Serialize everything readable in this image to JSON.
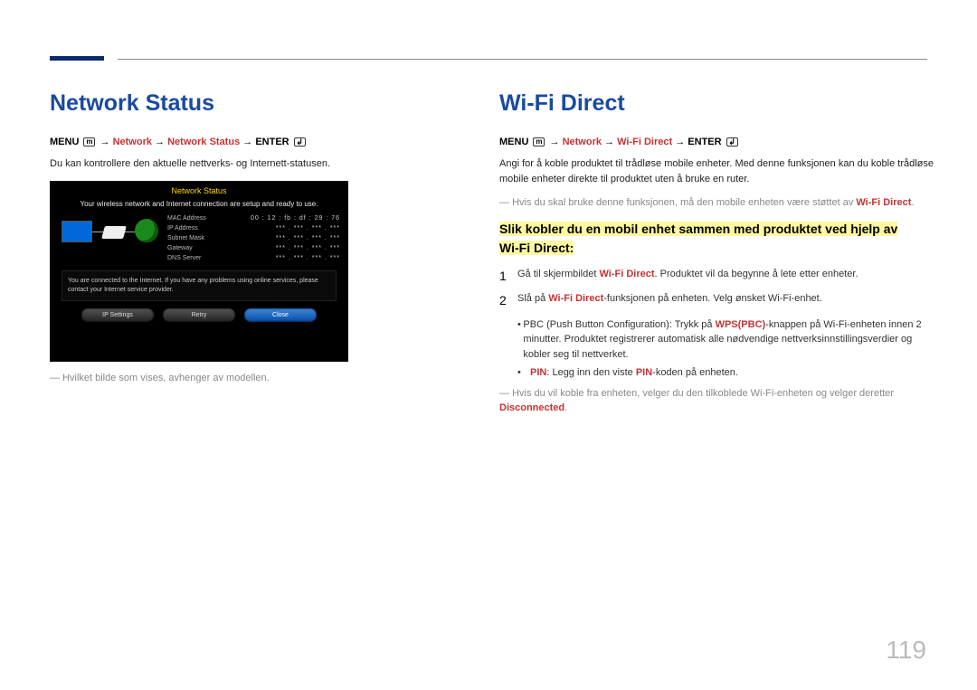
{
  "page_number": "119",
  "left": {
    "heading": "Network Status",
    "menu": {
      "prefix": "MENU",
      "item1": "Network",
      "item2": "Network Status",
      "suffix": "ENTER",
      "arrow": "→"
    },
    "intro": "Du kan kontrollere den aktuelle nettverks- og Internett-statusen.",
    "ss": {
      "title": "Network Status",
      "subtitle": "Your wireless network and Internet connection are setup and ready to use.",
      "rows": [
        {
          "label": "MAC Address",
          "value": "00 : 12 : fb : df : 29 : 76"
        },
        {
          "label": "IP Address",
          "value": "*** . *** . *** . ***"
        },
        {
          "label": "Subnet Mask",
          "value": "*** . *** . *** . ***"
        },
        {
          "label": "Gateway",
          "value": "*** . *** . *** . ***"
        },
        {
          "label": "DNS Server",
          "value": "*** . *** . *** . ***"
        }
      ],
      "msg": "You are connected to the Internet. If you have any problems using online services, please contact your Internet service provider.",
      "btn1": "IP Settings",
      "btn2": "Retry",
      "btn3": "Close"
    },
    "note": "Hvilket bilde som vises, avhenger av modellen."
  },
  "right": {
    "heading": "Wi-Fi Direct",
    "menu": {
      "prefix": "MENU",
      "item1": "Network",
      "item2": "Wi-Fi Direct",
      "suffix": "ENTER",
      "arrow": "→"
    },
    "intro": "Angi for å koble produktet til trådløse mobile enheter. Med denne funksjonen kan du koble trådløse mobile enheter direkte til produktet uten å bruke en ruter.",
    "note1_pre": "Hvis du skal bruke denne funksjonen, må den mobile enheten være støttet av ",
    "note1_red": "Wi-Fi Direct",
    "note1_post": ".",
    "h3_line1": "Slik kobler du en mobil enhet sammen med produktet ved hjelp av",
    "h3_line2": "Wi-Fi Direct:",
    "steps": [
      {
        "n": "1",
        "pre": "Gå til skjermbildet ",
        "red": "Wi-Fi Direct",
        "post": ". Produktet vil da begynne å lete etter enheter."
      },
      {
        "n": "2",
        "pre": "Slå på ",
        "red": "Wi-Fi Direct",
        "post": "-funksjonen på enheten. Velg ønsket Wi-Fi-enhet."
      }
    ],
    "bullets": [
      {
        "pre": "PBC (Push Button Configuration): Trykk på ",
        "red": "WPS(PBC)",
        "post": "-knappen på Wi-Fi-enheten innen 2 minutter. Produktet registrerer automatisk alle nødvendige nettverksinnstillingsverdier og kobler seg til nettverket."
      },
      {
        "preBold": "PIN",
        "pre": ": Legg inn den viste ",
        "red": "PIN",
        "post": "-koden på enheten."
      }
    ],
    "note2_pre": "Hvis du vil koble fra enheten, velger du den tilkoblede Wi-Fi-enheten og velger deretter ",
    "note2_red": "Disconnected",
    "note2_post": "."
  }
}
